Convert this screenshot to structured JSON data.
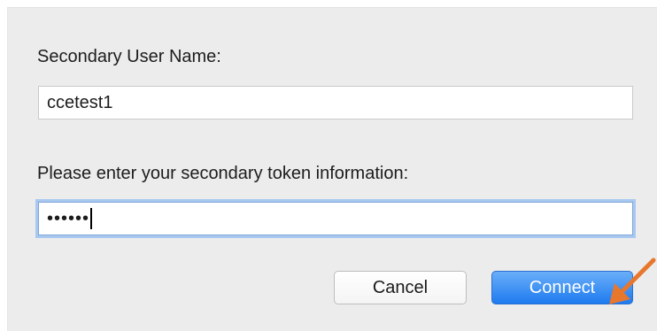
{
  "dialog": {
    "secondary_user_label": "Secondary User Name:",
    "secondary_user_value": "ccetest1",
    "token_label": "Please enter your secondary token information:",
    "token_value_masked": "••••••"
  },
  "buttons": {
    "cancel_label": "Cancel",
    "connect_label": "Connect"
  },
  "colors": {
    "accent": "#1e7bf0",
    "focus_ring": "#a9c8f0",
    "annotation_arrow": "#e8772e"
  }
}
